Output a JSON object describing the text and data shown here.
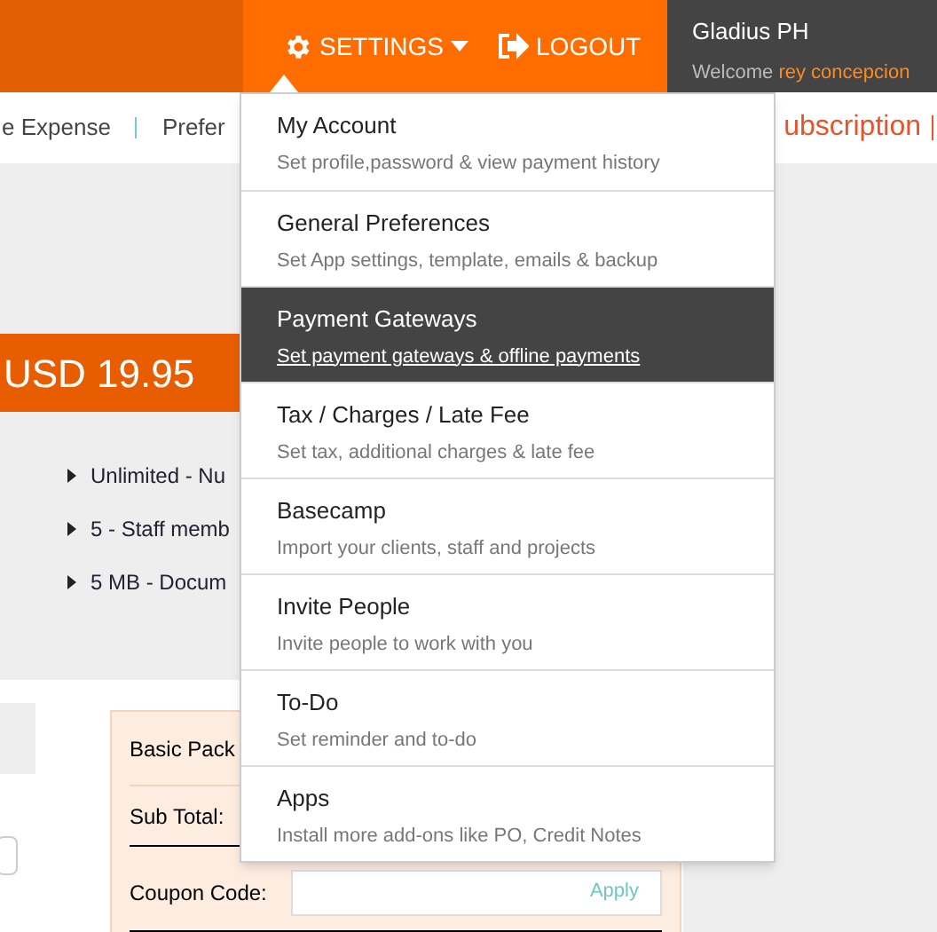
{
  "topbar": {
    "settings": "SETTINGS",
    "logout": "LOGOUT",
    "company": "Gladius PH",
    "welcome": "Welcome",
    "user": "rey concepcion"
  },
  "subnav": {
    "items": [
      "e Expense",
      "Prefer"
    ],
    "right": "ubscription"
  },
  "price": "USD 19.95",
  "features": [
    "Unlimited - Nu",
    "5 - Staff memb",
    "5 MB - Docum"
  ],
  "summary": {
    "rows": [
      "Basic Pack",
      "Sub Total:"
    ],
    "coupon_label": "Coupon Code:",
    "apply": "Apply"
  },
  "menu": [
    {
      "title": "My Account",
      "subtitle": "Set profile,password & view payment history",
      "selected": false
    },
    {
      "title": "General Preferences",
      "subtitle": "Set App settings, template, emails & backup",
      "selected": false
    },
    {
      "title": "Payment Gateways",
      "subtitle": "Set payment gateways & offline payments",
      "selected": true
    },
    {
      "title": "Tax / Charges / Late Fee",
      "subtitle": "Set tax, additional charges & late fee",
      "selected": false
    },
    {
      "title": "Basecamp",
      "subtitle": "Import your clients, staff and projects",
      "selected": false
    },
    {
      "title": "Invite People",
      "subtitle": "Invite people to work with you",
      "selected": false
    },
    {
      "title": "To-Do",
      "subtitle": "Set reminder and to-do",
      "selected": false
    },
    {
      "title": "Apps",
      "subtitle": "Install more add-ons like PO, Credit Notes",
      "selected": false
    }
  ]
}
